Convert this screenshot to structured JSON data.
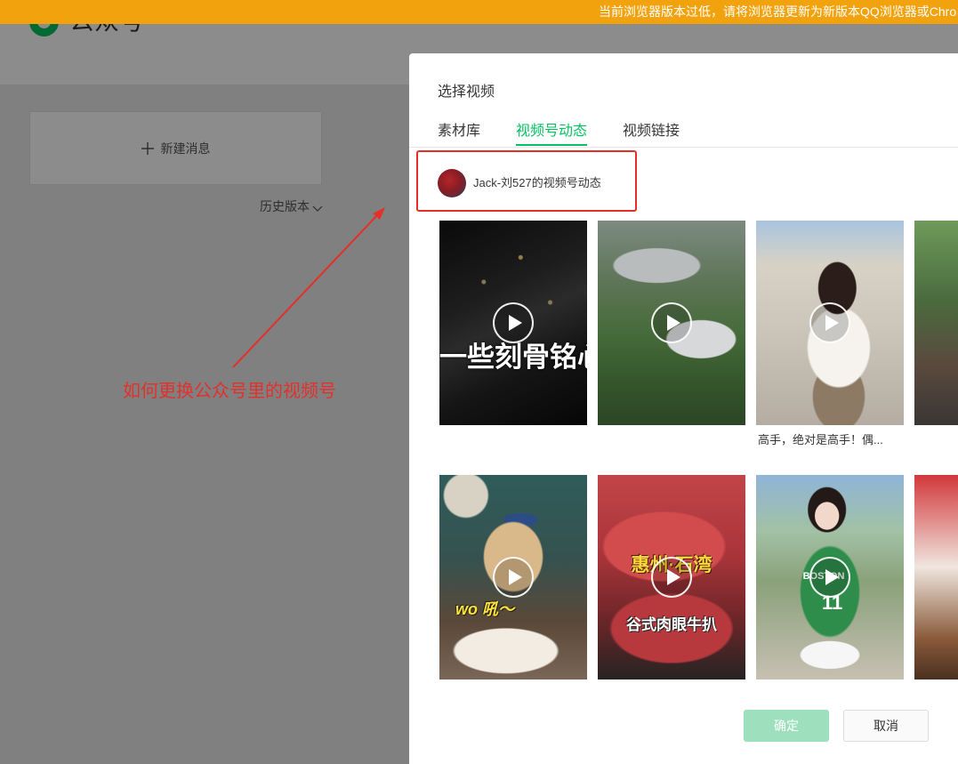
{
  "banner": {
    "text": "当前浏览器版本过低，请将浏览器更新为新版本QQ浏览器或Chro"
  },
  "background_page": {
    "logo_text": "公众号",
    "new_message_label": "新建消息",
    "history_label": "历史版本"
  },
  "annotation": {
    "text": "如何更换公众号里的视频号"
  },
  "modal": {
    "title": "选择视频",
    "tabs": [
      {
        "label": "素材库",
        "active": false
      },
      {
        "label": "视频号动态",
        "active": true
      },
      {
        "label": "视频链接",
        "active": false
      }
    ],
    "channel": {
      "name": "Jack-刘527的视频号动态"
    },
    "videos": [
      {
        "icon": "play-icon",
        "overlay_lines": [
          "一些刻骨铭心"
        ]
      },
      {
        "icon": "play-icon"
      },
      {
        "icon": "play-icon",
        "caption": "高手，绝对是高手！偶..."
      },
      {
        "icon": "play-icon"
      },
      {
        "icon": "play-icon",
        "overlay_lines": [
          "wo 吼～"
        ]
      },
      {
        "icon": "play-icon",
        "overlay_lines": [
          "惠州·石湾",
          "谷式肉眼牛扒"
        ]
      },
      {
        "icon": "play-icon",
        "overlay_lines": [
          "BOSTON",
          "11"
        ]
      },
      {
        "icon": "play-icon"
      }
    ],
    "buttons": {
      "confirm": "确定",
      "cancel": "取消"
    }
  },
  "colors": {
    "accent": "#07c160",
    "banner": "#f1a20c",
    "annotation": "#e3302b",
    "confirm_disabled": "#9ee0bd"
  }
}
